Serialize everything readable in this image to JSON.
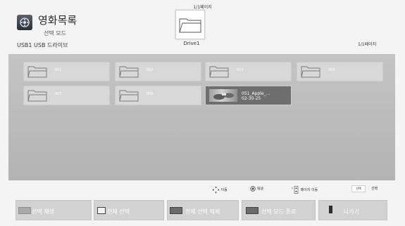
{
  "header": {
    "icon": "movie-list-icon",
    "title": "영화목록",
    "subtitle": "선택 모드",
    "device": "USB1   USB 드라이브",
    "page_info_top": "1/1페이지",
    "page_info_right": "1/1페이지",
    "drive_icon": "folder-icon",
    "drive_label": "Drive1"
  },
  "items": [
    {
      "type": "folder",
      "name": "001",
      "icon": "folder-icon"
    },
    {
      "type": "folder",
      "name": "002",
      "icon": "folder-icon"
    },
    {
      "type": "folder",
      "name": "003",
      "icon": "folder-icon"
    },
    {
      "type": "folder",
      "name": "004",
      "icon": "folder-icon"
    },
    {
      "type": "folder",
      "name": "005",
      "icon": "folder-icon"
    },
    {
      "type": "folder",
      "name": "006",
      "icon": "folder-icon"
    },
    {
      "type": "video",
      "name": "051_Apple_...",
      "date": "02-30-25",
      "icon": "video-thumbnail"
    }
  ],
  "help": {
    "move": "이동",
    "play": "재생",
    "page_move": "페이지 이동",
    "select_key": "선택",
    "select": "선택",
    "icons": [
      "dpad-icon",
      "ok-button-icon",
      "page-key-icon",
      "select-key-icon"
    ]
  },
  "buttons": [
    {
      "label": "선택 재생",
      "color": "#a9a9a9",
      "icon": "color-key-icon"
    },
    {
      "label": "전체 선택",
      "color": "#f2f2f2",
      "icon": "color-key-icon"
    },
    {
      "label": "전체 선택 해제",
      "color": "#6b6b6b",
      "icon": "color-key-icon"
    },
    {
      "label": "선택 모드 종료",
      "color": "#6b6b6b",
      "icon": "color-key-icon"
    },
    {
      "label": "나가기",
      "color": "#2b2b2b",
      "icon": "back-key-icon"
    }
  ],
  "colors": {
    "background": "#f4f4f4",
    "panel": "#bdbdbd",
    "tile": "#d8d8d8",
    "selected_tile": "#6e6e6e",
    "button": "#d2d2d2"
  }
}
